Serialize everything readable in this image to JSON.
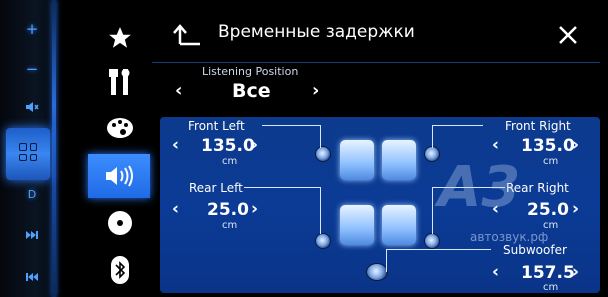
{
  "header": {
    "title": "Временные задержки"
  },
  "listening_position": {
    "label": "Listening Position",
    "value": "Все"
  },
  "channels": {
    "front_left": {
      "label": "Front Left",
      "value": "135.0",
      "unit": "cm"
    },
    "rear_left": {
      "label": "Rear Left",
      "value": "25.0",
      "unit": "cm"
    },
    "front_right": {
      "label": "Front Right",
      "value": "135.0",
      "unit": "cm"
    },
    "rear_right": {
      "label": "Rear Right",
      "value": "25.0",
      "unit": "cm"
    },
    "subwoofer": {
      "label": "Subwoofer",
      "value": "157.5",
      "unit": "cm"
    }
  },
  "watermark": {
    "logo": "A3",
    "text": "автозвук.рф"
  },
  "hw_buttons": {
    "plus": "+",
    "minus": "−",
    "d": "D"
  }
}
